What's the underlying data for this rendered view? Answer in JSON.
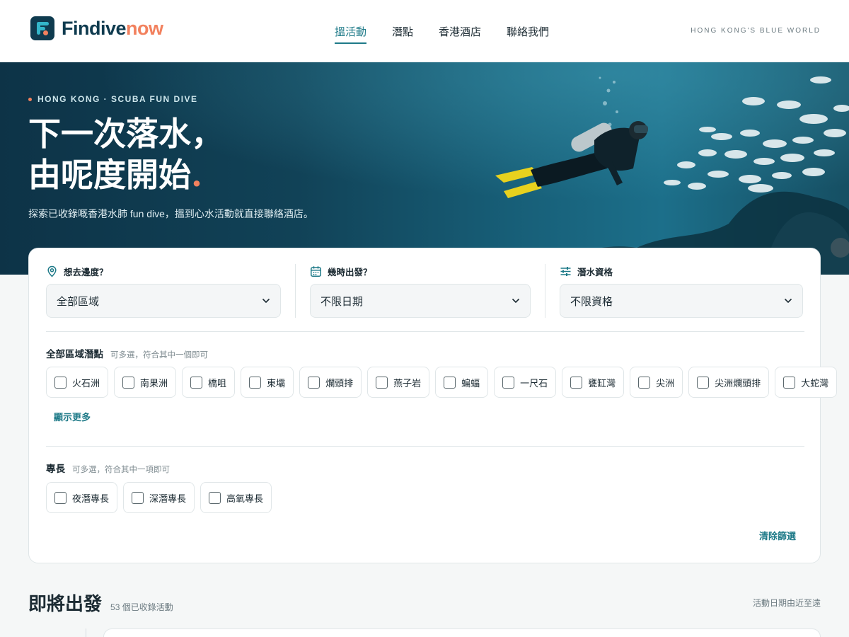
{
  "header": {
    "brand_main": "Findive",
    "brand_accent": "now",
    "nav": [
      {
        "label": "搵活動",
        "active": true
      },
      {
        "label": "潛點",
        "active": false
      },
      {
        "label": "香港酒店",
        "active": false
      },
      {
        "label": "聯絡我們",
        "active": false
      }
    ],
    "tagline": "HONG KONG'S BLUE WORLD"
  },
  "hero": {
    "eyebrow": "HONG KONG · SCUBA FUN DIVE",
    "title_line1": "下一次落水，",
    "title_line2": "由呢度開始",
    "title_dot": ".",
    "subtitle": "探索已收錄嘅香港水肺 fun dive，搵到心水活動就直接聯絡酒店。"
  },
  "filters": {
    "location": {
      "label": "想去邊度？",
      "value": "全部區域",
      "icon": "location-pin-icon"
    },
    "date": {
      "label": "幾時出發？",
      "value": "不限日期",
      "icon": "calendar-icon"
    },
    "cert": {
      "label": "潛水資格",
      "value": "不限資格",
      "icon": "sliders-icon"
    },
    "sites": {
      "title": "全部區域潛點",
      "hint": "可多選，符合其中一個即可",
      "options": [
        "火石洲",
        "南果洲",
        "橋咀",
        "東壩",
        "爛頭排",
        "燕子岩",
        "蝙蝠",
        "一尺石",
        "甕缸灣",
        "尖洲",
        "尖洲爛頭排",
        "大蛇灣"
      ],
      "show_more": "顯示更多"
    },
    "specialties": {
      "title": "專長",
      "hint": "可多選，符合其中一項即可",
      "options": [
        "夜潛專長",
        "深潛專長",
        "高氧專長"
      ]
    },
    "clear": "清除篩選"
  },
  "results": {
    "title": "即將出發",
    "count": "53 個已收錄活動",
    "sort": "活動日期由近至遠"
  },
  "colors": {
    "brand": "#0f3b4f",
    "accent": "#f2815e",
    "teal": "#1e7a88"
  }
}
